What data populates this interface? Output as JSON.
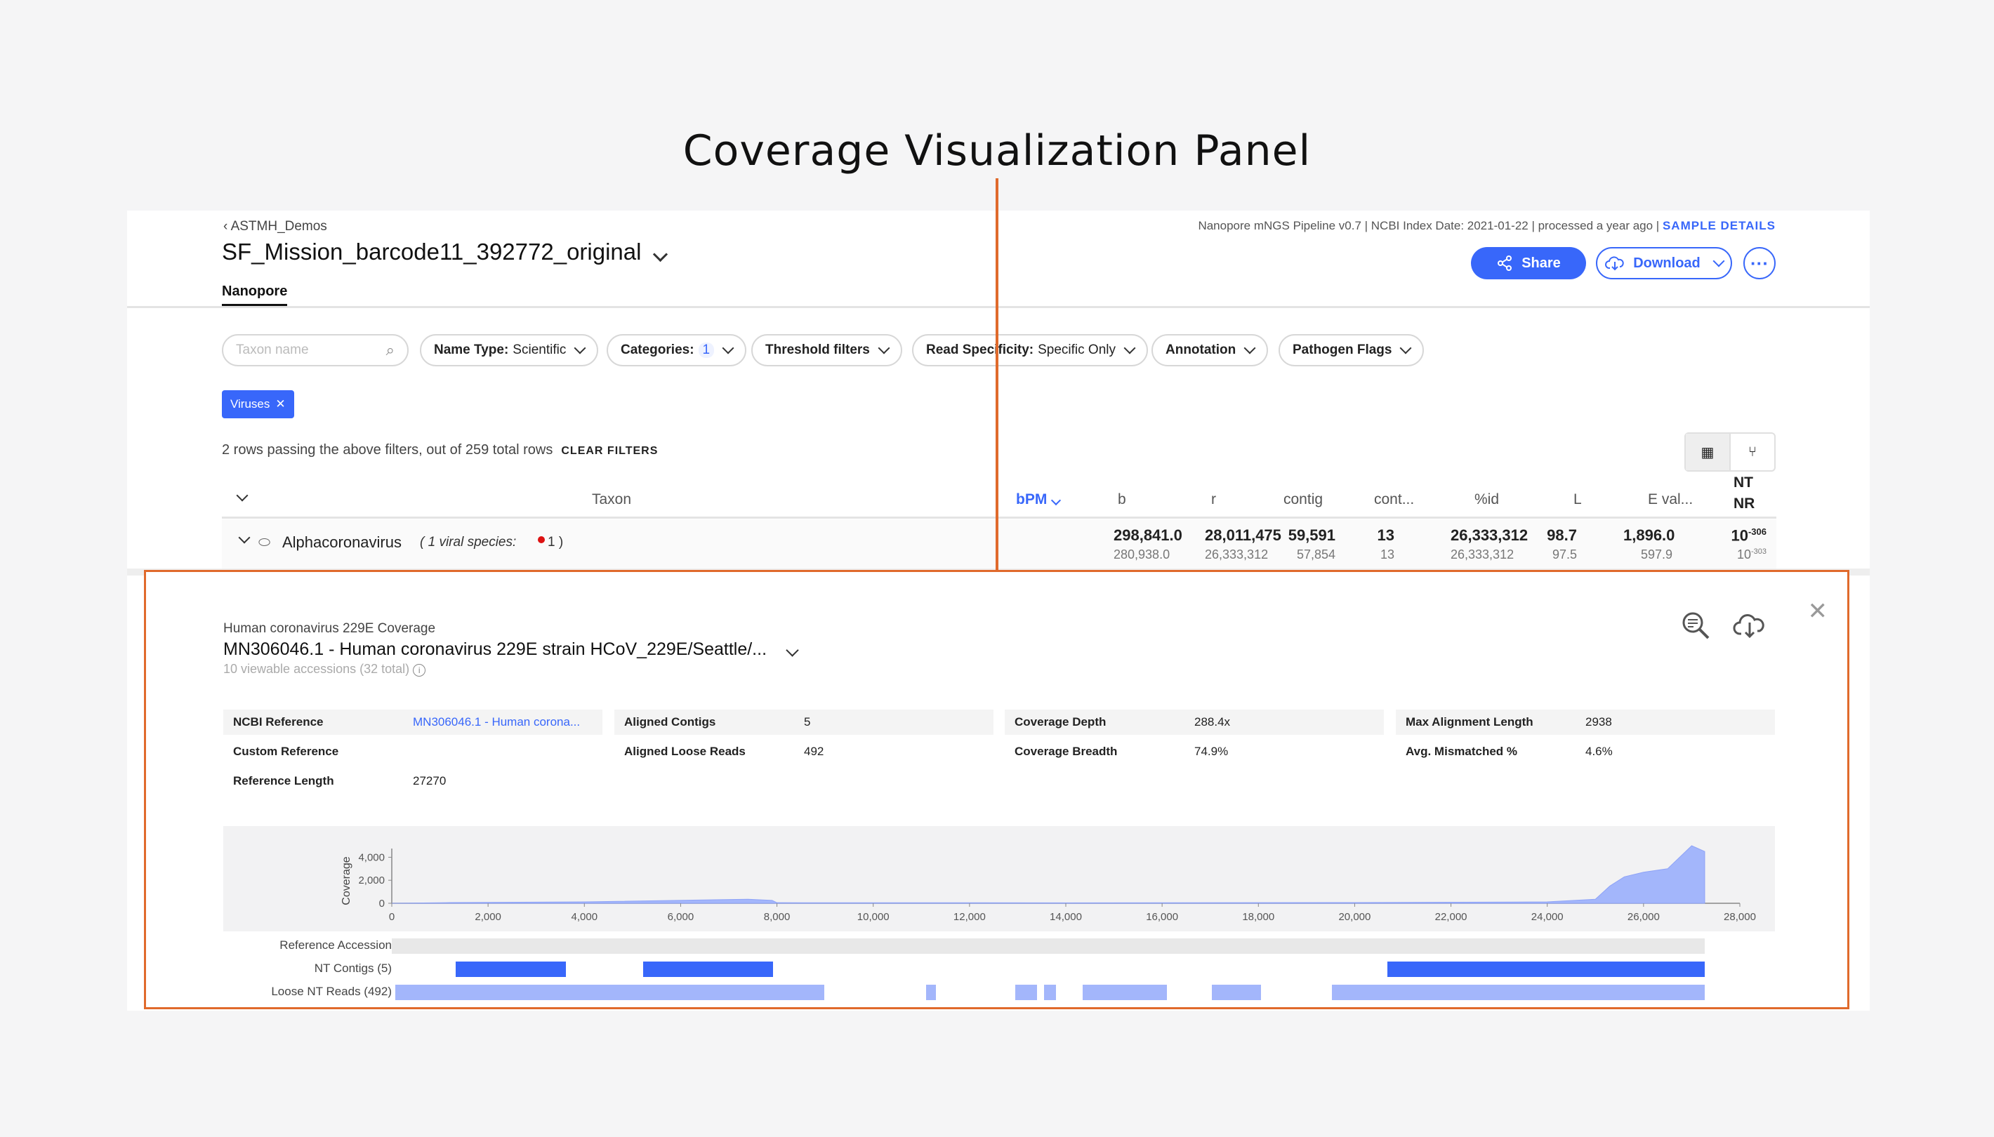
{
  "annotation": {
    "title": "Coverage Visualization Panel",
    "accent": "#e06a2c"
  },
  "header": {
    "breadcrumb": "ASTMH_Demos",
    "sample_name": "SF_Mission_barcode11_392772_original",
    "tab": "Nanopore",
    "pipeline_info": "Nanopore mNGS Pipeline v0.7 | NCBI Index Date: 2021-01-22 | processed a year ago |",
    "sample_details_link": "SAMPLE DETAILS",
    "share_label": "Share",
    "download_label": "Download"
  },
  "filters": {
    "search_placeholder": "Taxon name",
    "name_type_label": "Name Type:",
    "name_type_value": "Scientific",
    "categories_label": "Categories:",
    "categories_count": "1",
    "threshold_label": "Threshold filters",
    "read_spec_label": "Read Specificity:",
    "read_spec_value": "Specific Only",
    "annotation_label": "Annotation",
    "pathogen_label": "Pathogen Flags",
    "chip_label": "Viruses",
    "rows_info": "2 rows passing the above filters, out of 259 total rows",
    "clear_label": "CLEAR FILTERS"
  },
  "table": {
    "headers": [
      "Taxon",
      "bPM",
      "b",
      "r",
      "contig",
      "cont...",
      "%id",
      "L",
      "E val...",
      "NT",
      "NR"
    ],
    "row": {
      "taxon": "Alphacoronavirus",
      "species_note": "( 1 viral species:",
      "species_count": "1 )",
      "bpm": [
        "298,841.0",
        "280,938.0"
      ],
      "b": [
        "28,011,475",
        "26,333,312"
      ],
      "r": [
        "59,591",
        "57,854"
      ],
      "contig": [
        "13",
        "13"
      ],
      "cont": [
        "26,333,312",
        "26,333,312"
      ],
      "pid": [
        "98.7",
        "97.5"
      ],
      "L": [
        "1,896.0",
        "597.9"
      ],
      "eval_base": [
        "10",
        "10"
      ],
      "eval_exp": [
        "-306",
        "-303"
      ]
    }
  },
  "coverage": {
    "subtitle": "Human coronavirus 229E Coverage",
    "title": "MN306046.1 - Human coronavirus 229E strain HCoV_229E/Seattle/...",
    "accessions": "10 viewable accessions (32 total)",
    "metrics": [
      {
        "key": "NCBI Reference",
        "value": "MN306046.1 - Human corona..."
      },
      {
        "key": "Custom Reference",
        "value": ""
      },
      {
        "key": "Reference Length",
        "value": "27270"
      },
      {
        "key": "Aligned Contigs",
        "value": "5"
      },
      {
        "key": "Aligned Loose Reads",
        "value": "492"
      },
      {
        "key": "Coverage Depth",
        "value": "288.4x"
      },
      {
        "key": "Coverage Breadth",
        "value": "74.9%"
      },
      {
        "key": "Max Alignment Length",
        "value": "2938"
      },
      {
        "key": "Avg. Mismatched %",
        "value": "4.6%"
      }
    ],
    "track_labels": [
      "Reference Accession",
      "NT Contigs (5)",
      "Loose NT Reads (492)"
    ],
    "colors": {
      "contig": "#3867fa",
      "loose": "#a3b6fb",
      "area": "#a3b6fb",
      "link": "#3867fa"
    }
  },
  "chart_data": {
    "type": "area",
    "ylabel": "Coverage",
    "xlim": [
      0,
      28000
    ],
    "ylim": [
      0,
      5000
    ],
    "x_ticks": [
      "0",
      "2,000",
      "4,000",
      "6,000",
      "8,000",
      "10,000",
      "12,000",
      "14,000",
      "16,000",
      "18,000",
      "20,000",
      "22,000",
      "24,000",
      "26,000",
      "28,000"
    ],
    "y_ticks": [
      "0",
      "2,000",
      "4,000"
    ],
    "x": [
      0,
      1200,
      4000,
      7400,
      7900,
      8000,
      14000,
      20000,
      24000,
      25000,
      25300,
      25600,
      26000,
      26500,
      27000,
      27270
    ],
    "values": [
      0,
      60,
      120,
      350,
      250,
      50,
      40,
      60,
      120,
      350,
      1500,
      2300,
      2700,
      3000,
      5000,
      4500
    ]
  },
  "tracks": {
    "reference": [
      [
        0,
        27270
      ]
    ],
    "nt_contigs": [
      [
        1320,
        3620
      ],
      [
        5220,
        7920
      ],
      [
        20680,
        27270
      ]
    ],
    "loose_reads": [
      [
        80,
        8980
      ],
      [
        11100,
        11300
      ],
      [
        12950,
        13400
      ],
      [
        13550,
        13800
      ],
      [
        14350,
        16100
      ],
      [
        17030,
        18050
      ],
      [
        19520,
        27270
      ]
    ]
  }
}
